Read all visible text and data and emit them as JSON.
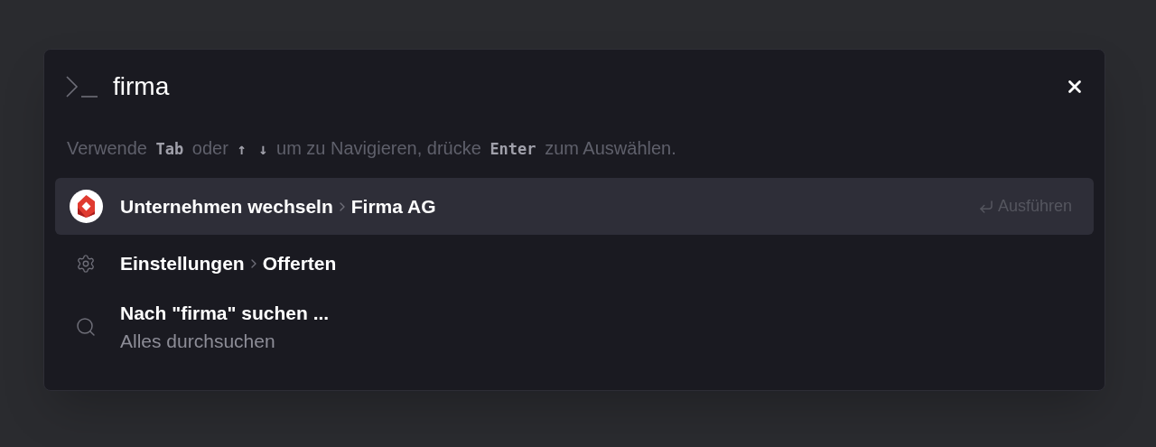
{
  "search": {
    "value": "firma"
  },
  "hint": [
    {
      "kind": "text",
      "text": "Verwende"
    },
    {
      "kind": "key",
      "text": "Tab"
    },
    {
      "kind": "text",
      "text": "oder"
    },
    {
      "kind": "key",
      "text": "↑"
    },
    {
      "kind": "key",
      "text": "↓"
    },
    {
      "kind": "text",
      "text": "um zu Navigieren, drücke"
    },
    {
      "kind": "key",
      "text": "Enter"
    },
    {
      "kind": "text",
      "text": "zum Auswählen."
    }
  ],
  "results": [
    {
      "kind": "company",
      "selected": true,
      "title": "Unternehmen wechseln",
      "target": "Firma AG",
      "action": "Ausführen"
    },
    {
      "kind": "settings",
      "selected": false,
      "title": "Einstellungen",
      "target": "Offerten"
    },
    {
      "kind": "search",
      "selected": false,
      "title": "Nach \"firma\" suchen ...",
      "subtitle": "Alles durchsuchen"
    }
  ]
}
